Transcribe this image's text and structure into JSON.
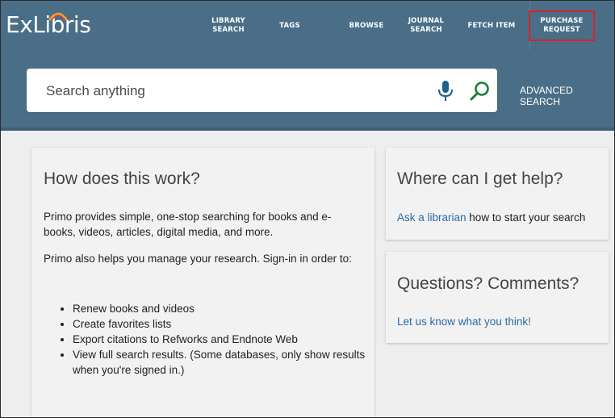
{
  "header": {
    "logo_text": "ExLibris",
    "nav": [
      {
        "label": "LIBRARY SEARCH"
      },
      {
        "label": "TAGS"
      },
      {
        "label": "BROWSE"
      },
      {
        "label": "JOURNAL SEARCH"
      },
      {
        "label": "FETCH ITEM"
      },
      {
        "label": "PURCHASE REQUEST"
      }
    ]
  },
  "search": {
    "placeholder": "Search anything",
    "advanced_label": "ADVANCED SEARCH",
    "icons": {
      "mic": "microphone-icon",
      "search": "search-icon"
    },
    "accent": "#1a7f3a"
  },
  "cards": {
    "how": {
      "title": "How does this work?",
      "p1": "Primo provides simple, one-stop searching for books and e-books, videos, articles, digital media, and more.",
      "p2": "Primo also helps you manage your research. Sign-in in order to:",
      "items": [
        "Renew books and videos",
        "Create favorites lists",
        "Export citations to Refworks and Endnote Web",
        "View full search results. (Some databases, only show results when you're signed in.)"
      ]
    },
    "help": {
      "title": "Where can I get help?",
      "link": "Ask a librarian",
      "rest": " how to start your search"
    },
    "questions": {
      "title": "Questions? Comments?",
      "link": "Let us know what you think!"
    }
  },
  "colors": {
    "header_bg": "#4a6e88",
    "highlight_border": "#d6232a",
    "link": "#2a6aa5"
  }
}
